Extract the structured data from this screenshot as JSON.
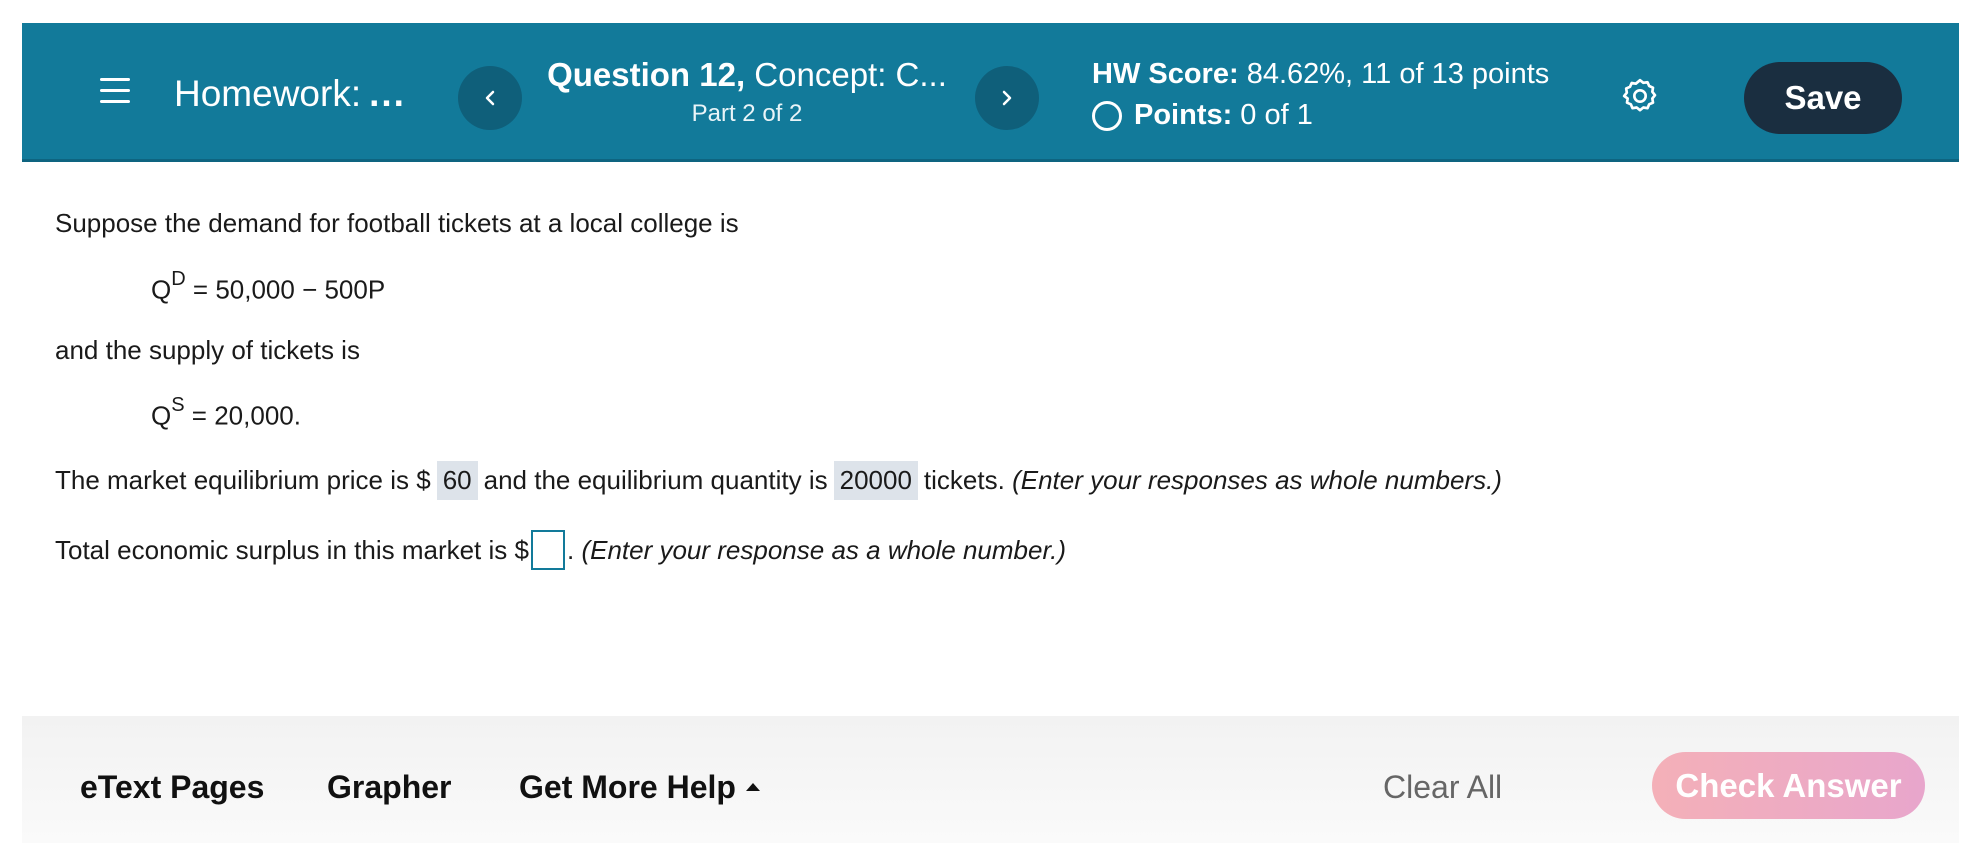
{
  "header": {
    "homework_label": "Homework:",
    "homework_ellipsis": "...",
    "question_title_bold": "Question 12,",
    "question_title_rest": " Concept: C...",
    "part_label": "Part 2 of 2",
    "hw_score_label": "HW Score:",
    "hw_score_value": " 84.62%, 11 of 13 points",
    "points_label": "Points:",
    "points_value": "0 of 1",
    "save_label": "Save",
    "colors": {
      "bar": "#127a9a",
      "save_button": "#1a2e40"
    }
  },
  "question": {
    "intro": "Suppose the demand for football tickets at a local college is",
    "demand_q": "Q",
    "demand_sup": "D",
    "demand_rhs": " = 50,000 − 500P",
    "supply_intro": "and the supply of tickets is",
    "supply_q": "Q",
    "supply_sup": "S",
    "supply_rhs": " = 20,000.",
    "eq_price_prefix": "The market equilibrium price is $",
    "eq_price_value": "60",
    "eq_qty_prefix": "and the equilibrium quantity is",
    "eq_qty_value": "20000",
    "eq_qty_suffix": "tickets.",
    "eq_instructions": "(Enter your responses as whole numbers.)",
    "surplus_prefix": "Total economic surplus in this market is $",
    "surplus_value": "",
    "surplus_suffix": ".",
    "surplus_instructions": "(Enter your response as a whole number.)"
  },
  "footer": {
    "etext_label": "eText Pages",
    "grapher_label": "Grapher",
    "more_help_label": "Get More Help",
    "clear_all_label": "Clear All",
    "check_answer_label": "Check Answer"
  }
}
